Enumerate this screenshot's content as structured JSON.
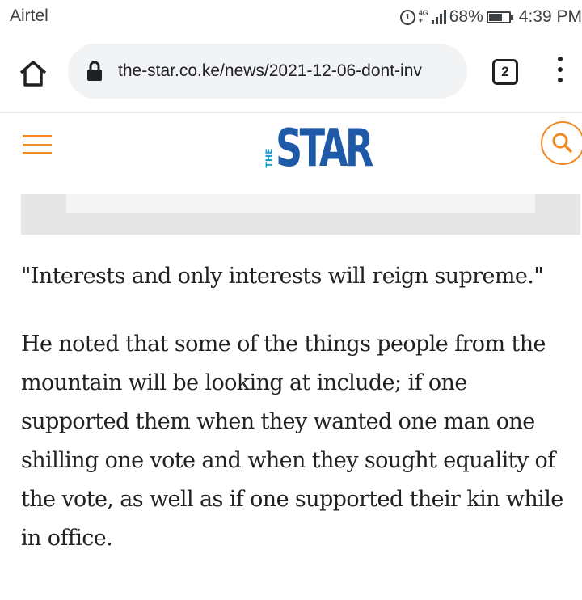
{
  "status_bar": {
    "carrier": "Airtel",
    "lte_badge": "1",
    "network_type_top": "4G",
    "network_type_bottom": "+",
    "battery": "68%",
    "battery_level": 0.68,
    "time": "4:39 PM"
  },
  "browser": {
    "url": "the-star.co.ke/news/2021-12-06-dont-inv",
    "tab_count": "2",
    "icons": {
      "home": "home-icon",
      "lock": "lock-icon",
      "menu": "more-vert-icon"
    }
  },
  "site": {
    "logo_small": "THE",
    "logo_main": "STAR",
    "icons": {
      "menu": "hamburger-icon",
      "search": "search-icon"
    },
    "colors": {
      "accent": "#f08a24",
      "logo": "#1e5aa8"
    }
  },
  "article": {
    "paragraphs": [
      "\"Interests and only interests will reign supreme.\"",
      "He noted that some of the things people from the mountain will be looking at include; if one supported them when they wanted one man one shilling one vote and when they sought equality of the vote, as well as if one supported their kin while in office."
    ]
  }
}
